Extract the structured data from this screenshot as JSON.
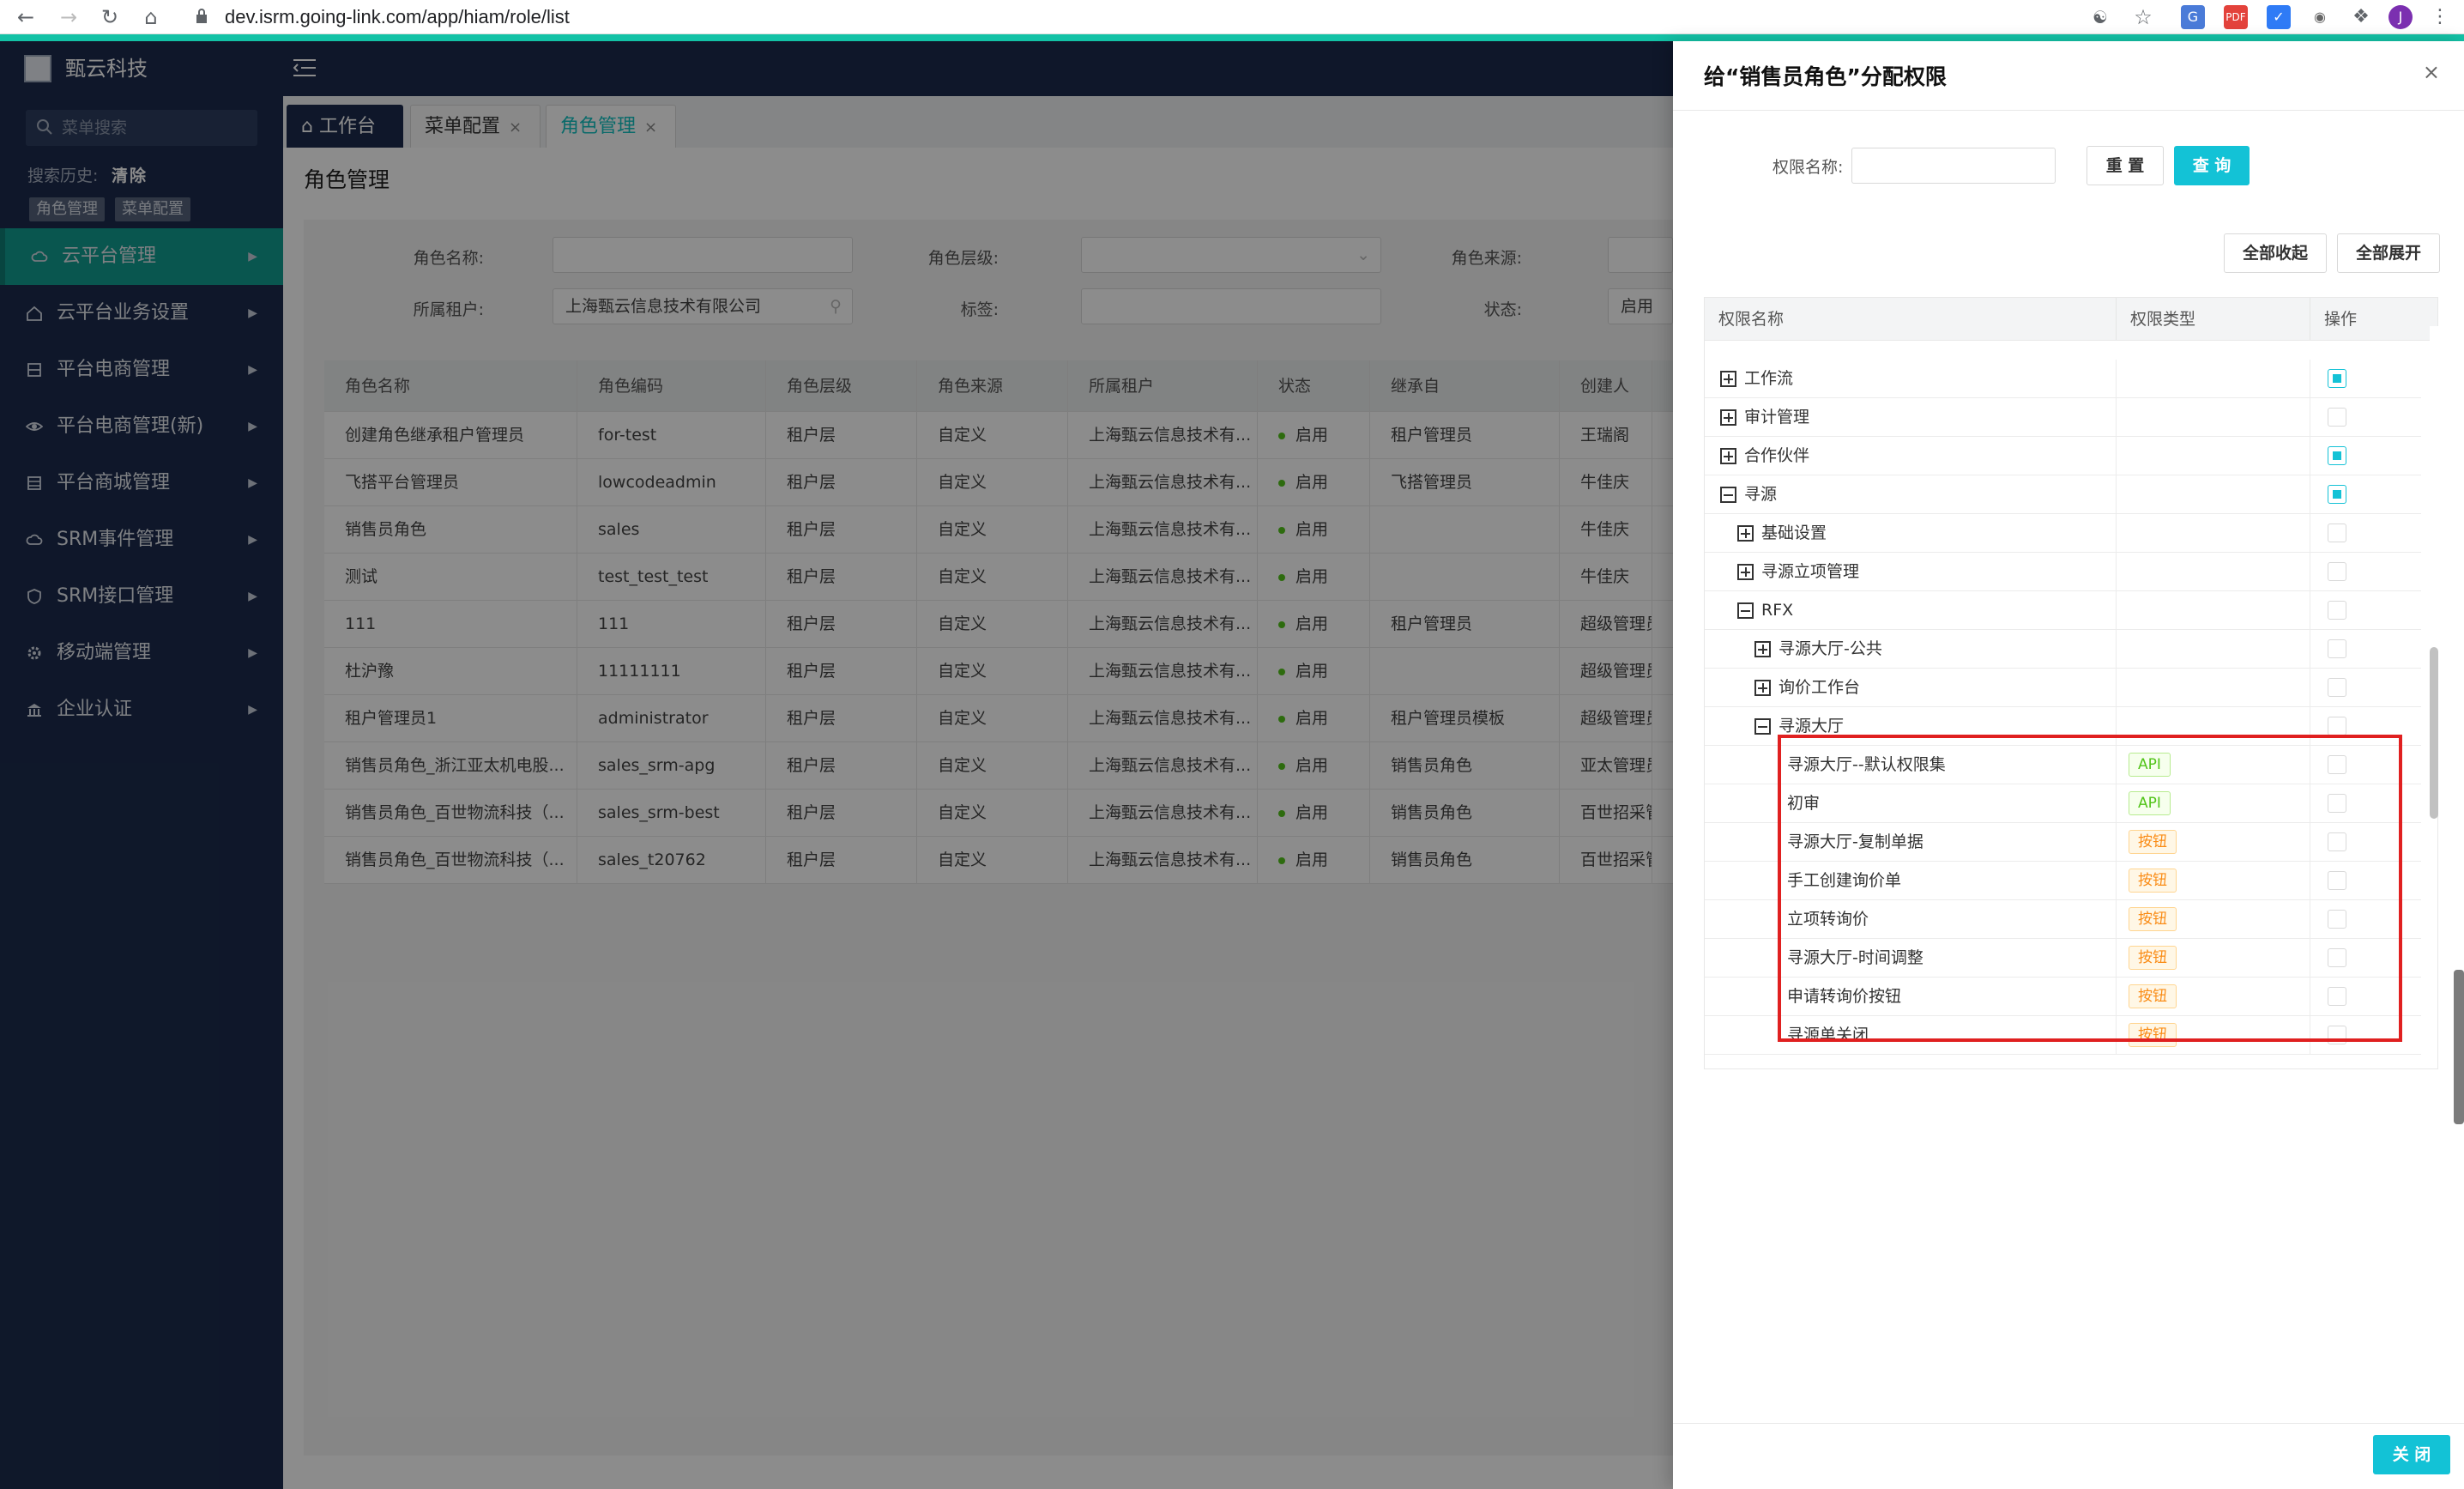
{
  "browser": {
    "url": "dev.isrm.going-link.com/app/hiam/role/list",
    "profile_initial": "J"
  },
  "sidebar": {
    "brand": "甄云科技",
    "search_placeholder": "菜单搜索",
    "history_label": "搜索历史:",
    "history_clear": "清除",
    "history_tags": [
      "角色管理",
      "菜单配置"
    ],
    "items": [
      {
        "label": "云平台管理",
        "icon": "cloud-icon",
        "active": true
      },
      {
        "label": "云平台业务设置",
        "icon": "home-icon"
      },
      {
        "label": "平台电商管理",
        "icon": "grid-icon"
      },
      {
        "label": "平台电商管理(新)",
        "icon": "eye-icon"
      },
      {
        "label": "平台商城管理",
        "icon": "table-icon"
      },
      {
        "label": "SRM事件管理",
        "icon": "cloud-icon"
      },
      {
        "label": "SRM接口管理",
        "icon": "shield-icon"
      },
      {
        "label": "移动端管理",
        "icon": "gear-icon"
      },
      {
        "label": "企业认证",
        "icon": "bank-icon"
      }
    ]
  },
  "tabs": [
    {
      "label": "工作台",
      "icon": "home-icon"
    },
    {
      "label": "菜单配置"
    },
    {
      "label": "角色管理"
    }
  ],
  "page": {
    "title": "角色管理",
    "filters": {
      "role_name_label": "角色名称:",
      "role_level_label": "角色层级:",
      "role_source_label": "角色来源:",
      "tenant_label": "所属租户:",
      "tenant_value": "上海甄云信息技术有限公司",
      "tag_label": "标签:",
      "status_label": "状态:",
      "status_value": "启用"
    },
    "grid_headers": [
      "角色名称",
      "角色编码",
      "角色层级",
      "角色来源",
      "所属租户",
      "状态",
      "继承自",
      "创建人"
    ],
    "grid_rows": [
      [
        "创建角色继承租户管理员",
        "for-test",
        "租户层",
        "自定义",
        "上海甄云信息技术有...",
        "启用",
        "租户管理员",
        "王瑞阁"
      ],
      [
        "飞搭平台管理员",
        "lowcodeadmin",
        "租户层",
        "自定义",
        "上海甄云信息技术有...",
        "启用",
        "飞搭管理员",
        "牛佳庆"
      ],
      [
        "销售员角色",
        "sales",
        "租户层",
        "自定义",
        "上海甄云信息技术有...",
        "启用",
        "",
        "牛佳庆"
      ],
      [
        "测试",
        "test_test_test",
        "租户层",
        "自定义",
        "上海甄云信息技术有...",
        "启用",
        "",
        "牛佳庆"
      ],
      [
        "111",
        "111",
        "租户层",
        "自定义",
        "上海甄云信息技术有...",
        "启用",
        "租户管理员",
        "超级管理员"
      ],
      [
        "杜沪豫",
        "11111111",
        "租户层",
        "自定义",
        "上海甄云信息技术有...",
        "启用",
        "",
        "超级管理员"
      ],
      [
        "租户管理员1",
        "administrator",
        "租户层",
        "自定义",
        "上海甄云信息技术有...",
        "启用",
        "租户管理员模板",
        "超级管理员"
      ],
      [
        "销售员角色_浙江亚太机电股...",
        "sales_srm-apg",
        "租户层",
        "自定义",
        "上海甄云信息技术有...",
        "启用",
        "销售员角色",
        "亚太管理员"
      ],
      [
        "销售员角色_百世物流科技（...",
        "sales_srm-best",
        "租户层",
        "自定义",
        "上海甄云信息技术有...",
        "启用",
        "销售员角色",
        "百世招采管理"
      ],
      [
        "销售员角色_百世物流科技（...",
        "sales_t20762",
        "租户层",
        "自定义",
        "上海甄云信息技术有...",
        "启用",
        "销售员角色",
        "百世招采管理"
      ]
    ]
  },
  "drawer": {
    "title": "给“销售员角色”分配权限",
    "perm_name_label": "权限名称:",
    "reset_label": "重 置",
    "query_label": "查 询",
    "collapse_all_label": "全部收起",
    "expand_all_label": "全部展开",
    "tree_headers": [
      "权限名称",
      "权限类型",
      "操作"
    ],
    "tree_rows": [
      {
        "label": "工作流",
        "level": 0,
        "expander": "plus",
        "type": "",
        "checked": true
      },
      {
        "label": "审计管理",
        "level": 0,
        "expander": "plus",
        "type": "",
        "checked": false
      },
      {
        "label": "合作伙伴",
        "level": 0,
        "expander": "plus",
        "type": "",
        "checked": true
      },
      {
        "label": "寻源",
        "level": 0,
        "expander": "minus",
        "type": "",
        "checked": true
      },
      {
        "label": "基础设置",
        "level": 1,
        "expander": "plus",
        "type": "",
        "checked": false
      },
      {
        "label": "寻源立项管理",
        "level": 1,
        "expander": "plus",
        "type": "",
        "checked": false
      },
      {
        "label": "RFX",
        "level": 1,
        "expander": "minus",
        "type": "",
        "checked": false
      },
      {
        "label": "寻源大厅-公共",
        "level": 2,
        "expander": "plus",
        "type": "",
        "checked": false
      },
      {
        "label": "询价工作台",
        "level": 2,
        "expander": "plus",
        "type": "",
        "checked": false
      },
      {
        "label": "寻源大厅",
        "level": 2,
        "expander": "minus",
        "type": "",
        "checked": false
      },
      {
        "label": "寻源大厅--默认权限集",
        "level": 3,
        "expander": "",
        "type": "API",
        "checked": false
      },
      {
        "label": "初审",
        "level": 3,
        "expander": "",
        "type": "API",
        "checked": false
      },
      {
        "label": "寻源大厅-复制单据",
        "level": 3,
        "expander": "",
        "type": "按钮",
        "checked": false
      },
      {
        "label": "手工创建询价单",
        "level": 3,
        "expander": "",
        "type": "按钮",
        "checked": false
      },
      {
        "label": "立项转询价",
        "level": 3,
        "expander": "",
        "type": "按钮",
        "checked": false
      },
      {
        "label": "寻源大厅-时间调整",
        "level": 3,
        "expander": "",
        "type": "按钮",
        "checked": false
      },
      {
        "label": "申请转询价按钮",
        "level": 3,
        "expander": "",
        "type": "按钮",
        "checked": false
      },
      {
        "label": "寻源单关闭",
        "level": 3,
        "expander": "",
        "type": "按钮",
        "checked": false
      }
    ],
    "close_label": "关 闭"
  },
  "colors": {
    "sidebar_bg": "#1c2b4d",
    "accent": "#13c2d6",
    "active_menu": "#129d91",
    "highlight_box": "#e02020"
  }
}
